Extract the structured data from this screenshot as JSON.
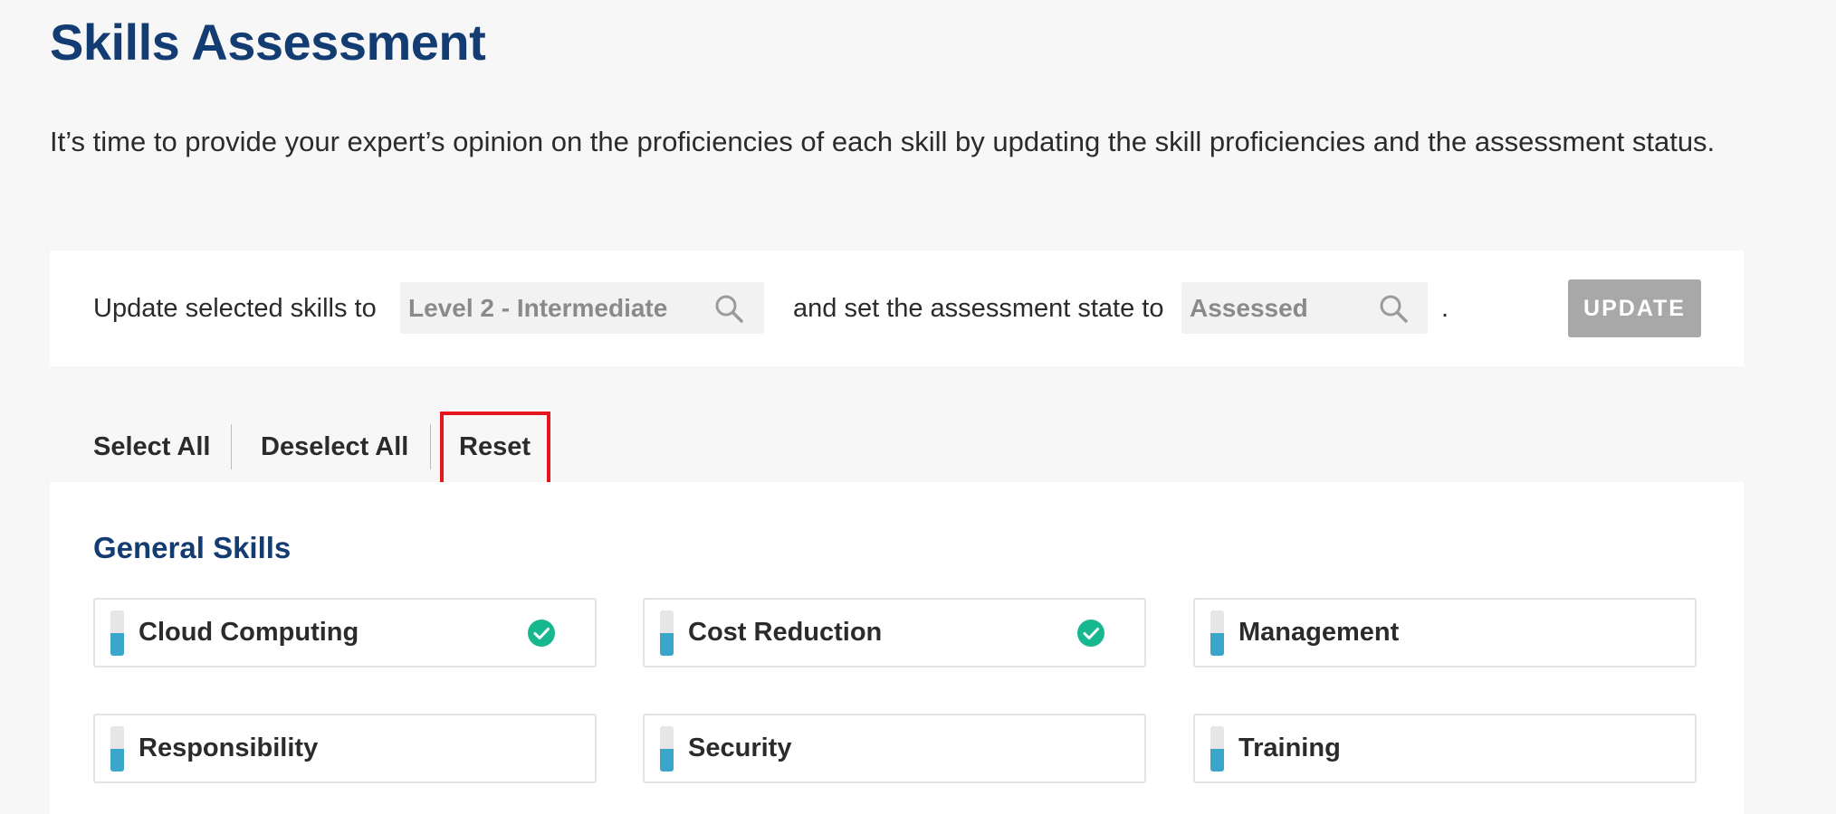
{
  "header": {
    "title": "Skills Assessment",
    "intro": "It’s time to provide your expert’s opinion on the proficiencies of each skill by updating the skill proficiencies and the assessment status."
  },
  "update_bar": {
    "prefix": "Update selected skills to",
    "level_value": "Level 2 - Intermediate",
    "middle": "and set the assessment state to",
    "state_value": "Assessed",
    "suffix": ".",
    "button_label": "UPDATE",
    "button_disabled": true,
    "search_icon": "search-icon"
  },
  "actions": {
    "select_all": "Select All",
    "deselect_all": "Deselect All",
    "reset": "Reset",
    "highlighted": "reset"
  },
  "general_skills": {
    "title": "General Skills",
    "skills": [
      {
        "name": "Cloud Computing",
        "level_fraction": 0.5,
        "assessed": true
      },
      {
        "name": "Cost Reduction",
        "level_fraction": 0.5,
        "assessed": true
      },
      {
        "name": "Management",
        "level_fraction": 0.5,
        "assessed": false
      },
      {
        "name": "Responsibility",
        "level_fraction": 0.5,
        "assessed": false
      },
      {
        "name": "Security",
        "level_fraction": 0.5,
        "assessed": false
      },
      {
        "name": "Training",
        "level_fraction": 0.5,
        "assessed": false
      }
    ]
  },
  "colors": {
    "title": "#133c72",
    "level_fill": "#3aa6cc",
    "check": "#17b890",
    "highlight": "#e5161c",
    "button_disabled": "#a8a8a8"
  }
}
